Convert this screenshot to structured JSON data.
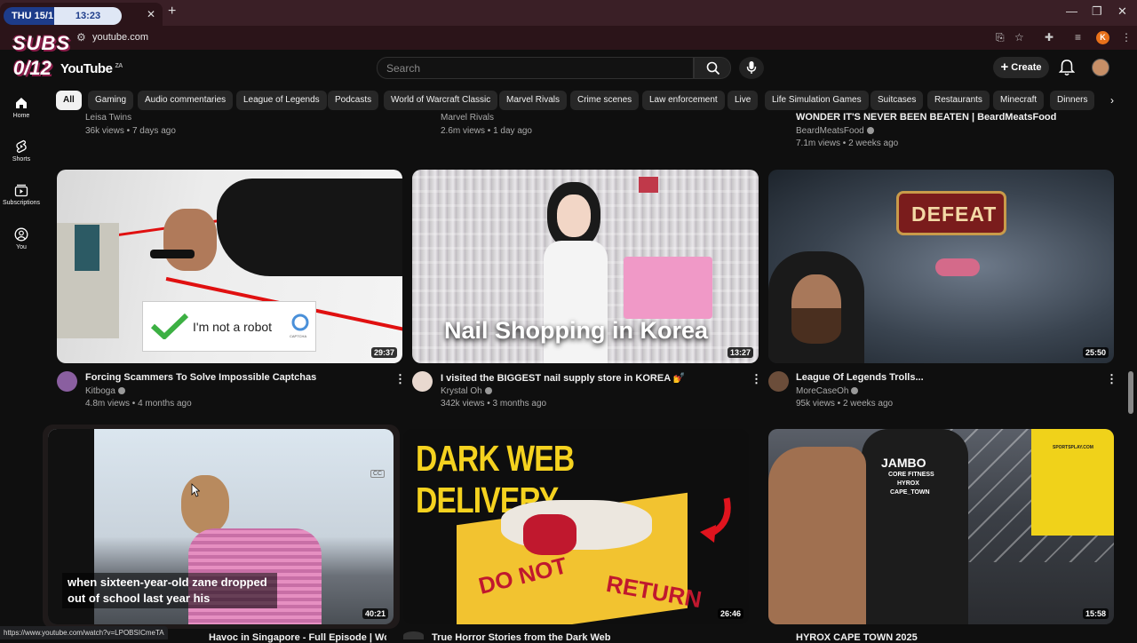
{
  "browser": {
    "date": "THU 15/1",
    "time": "13:23",
    "url": "youtube.com",
    "status_url": "https://www.youtube.com/watch?v=LPOBSICmeTA",
    "profile_letter": "K"
  },
  "overlay": {
    "subs_label": "SUBS",
    "subs_count": "0/12"
  },
  "header": {
    "logo": "YouTube",
    "country": "ZA",
    "search_placeholder": "Search",
    "create_label": "Create"
  },
  "sidebar": {
    "items": [
      {
        "label": "Home"
      },
      {
        "label": "Shorts"
      },
      {
        "label": "Subscriptions"
      },
      {
        "label": "You"
      }
    ]
  },
  "chips": [
    "All",
    "Gaming",
    "Audio commentaries",
    "League of Legends",
    "Podcasts",
    "World of Warcraft Classic",
    "Marvel Rivals",
    "Crime scenes",
    "Law enforcement",
    "Live",
    "Life Simulation Games",
    "Suitcases",
    "Restaurants",
    "Minecraft",
    "Dinners"
  ],
  "top_row": [
    {
      "channel": "Leisa Twins",
      "meta": "36k views • 7 days ago"
    },
    {
      "channel": "Marvel Rivals",
      "meta": "2.6m views • 1 day ago"
    },
    {
      "title": "WONDER IT'S NEVER BEEN BEATEN | BeardMeatsFood",
      "channel": "BeardMeatsFood",
      "meta": "7.1m views • 2 weeks ago"
    }
  ],
  "videos": [
    {
      "title": "Forcing Scammers To Solve Impossible Captchas",
      "channel": "Kitboga",
      "meta": "4.8m views • 4 months ago",
      "duration": "29:37",
      "thumb_text": "I'm not a robot",
      "captcha_label": "CAPTCHA"
    },
    {
      "title": "I visited the BIGGEST nail supply store in KOREA 💅",
      "channel": "Krystal Oh",
      "meta": "342k views • 3 months ago",
      "duration": "13:27",
      "thumb_text": "Nail Shopping in Korea"
    },
    {
      "title": "League Of Legends Trolls...",
      "channel": "MoreCaseOh",
      "meta": "95k views • 2 weeks ago",
      "duration": "25:50",
      "thumb_text": "DEFEAT"
    }
  ],
  "bottom_row": [
    {
      "title": "Havoc in Singapore - Full Episode | World's",
      "duration": "40:21",
      "caption": "when sixteen-year-old zane dropped out of school last year his",
      "cc": "CC"
    },
    {
      "title": "True Horror Stories from the Dark Web",
      "duration": "26:46",
      "thumb_text": "DARK WEB DELIVERY",
      "box_text_1": "DO NOT",
      "box_text_2": "RETURN"
    },
    {
      "title": "HYROX CAPE TOWN 2025",
      "duration": "15:58",
      "shirt_text_1": "JAMBO",
      "shirt_text_2": "CORE FITNESS",
      "shirt_text_3": "HYROX",
      "shirt_text_4": "CAPE_TOWN",
      "vest_text": "SPORTSPLAY.COM"
    }
  ]
}
